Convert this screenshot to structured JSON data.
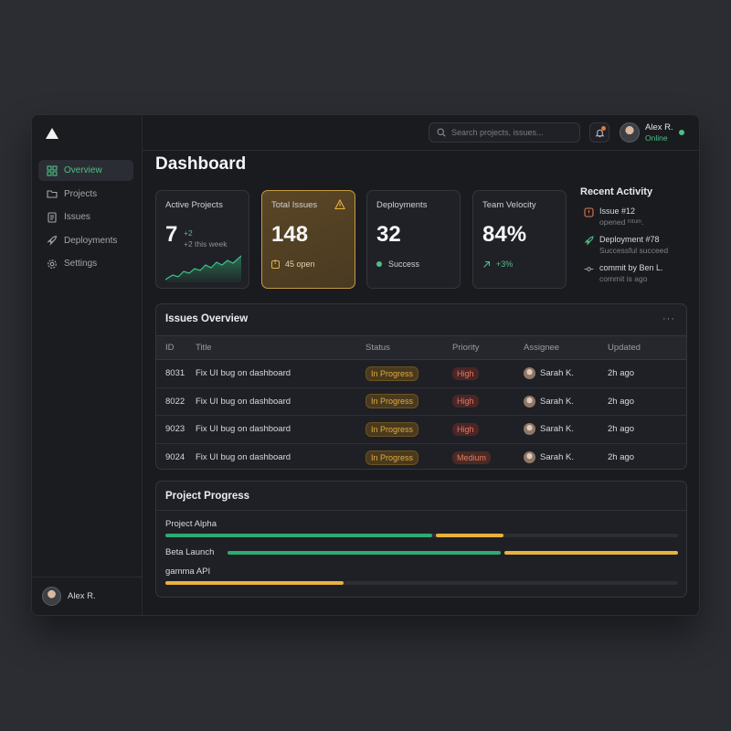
{
  "sidebar": {
    "items": [
      {
        "label": "Overview",
        "icon": "grid-icon",
        "active": true
      },
      {
        "label": "Projects",
        "icon": "folder-icon"
      },
      {
        "label": "Issues",
        "icon": "document-icon"
      },
      {
        "label": "Deployments",
        "icon": "rocket-icon"
      },
      {
        "label": "Settings",
        "icon": "gear-icon"
      }
    ],
    "user_name": "Alex R."
  },
  "topbar": {
    "search_placeholder": "Search projects, issues...",
    "user_name": "Alex R.",
    "user_status": "Online"
  },
  "page_title": "Dashboard",
  "cards": {
    "active_projects": {
      "label": "Active Projects",
      "value": "7",
      "delta": "+2",
      "delta_sub": "+2 this week"
    },
    "total_issues": {
      "label": "Total Issues",
      "value": "148",
      "sub": "45 open"
    },
    "deployments": {
      "label": "Deployments",
      "value": "32",
      "sub": "Success"
    },
    "team_velocity": {
      "label": "Team Velocity",
      "value": "84%",
      "sub": "+3%"
    }
  },
  "activity": {
    "title": "Recent Activity",
    "items": [
      {
        "title": "Issue #12",
        "sub": "opened ᵗʳᶦᵗᵘᵐ.",
        "icon": "alert-icon"
      },
      {
        "title": "Deployment #78",
        "sub": "Successful succeed",
        "icon": "rocket-icon"
      },
      {
        "title": "commit by Ben L.",
        "sub": "commit is ago",
        "icon": "commit-icon"
      }
    ]
  },
  "issues": {
    "title": "Issues Overview",
    "more": "···",
    "columns": [
      "ID",
      "Title",
      "Status",
      "Priority",
      "Assignee",
      "Updated"
    ],
    "rows": [
      {
        "id": "8031",
        "title": "Fix UI bug on dashboard",
        "status": "In Progress",
        "priority": "High",
        "assignee": "Sarah K.",
        "updated": "2h ago"
      },
      {
        "id": "8022",
        "title": "Fix UI bug on dashboard",
        "status": "In Progress",
        "priority": "High",
        "assignee": "Sarah K.",
        "updated": "2h ago"
      },
      {
        "id": "9023",
        "title": "Fix UI bug on dashboard",
        "status": "In Progress",
        "priority": "High",
        "assignee": "Sarah K.",
        "updated": "2h ago"
      },
      {
        "id": "9024",
        "title": "Fix UI bug on dashboard",
        "status": "In Progress",
        "priority": "Medium",
        "assignee": "Sarah K.",
        "updated": "2h ago"
      }
    ]
  },
  "progress": {
    "title": "Project Progress",
    "projects": [
      {
        "name": "Project Alpha",
        "green": 0.52,
        "yellow": 0.13
      },
      {
        "name": "Beta Launch",
        "green": 0.53,
        "yellow": 0.33
      },
      {
        "name": "gamma API",
        "green": 0,
        "yellow": 0.35
      }
    ]
  },
  "colors": {
    "accent_green": "#4fbf86",
    "accent_yellow": "#e9b23c",
    "danger": "#e5785f"
  }
}
